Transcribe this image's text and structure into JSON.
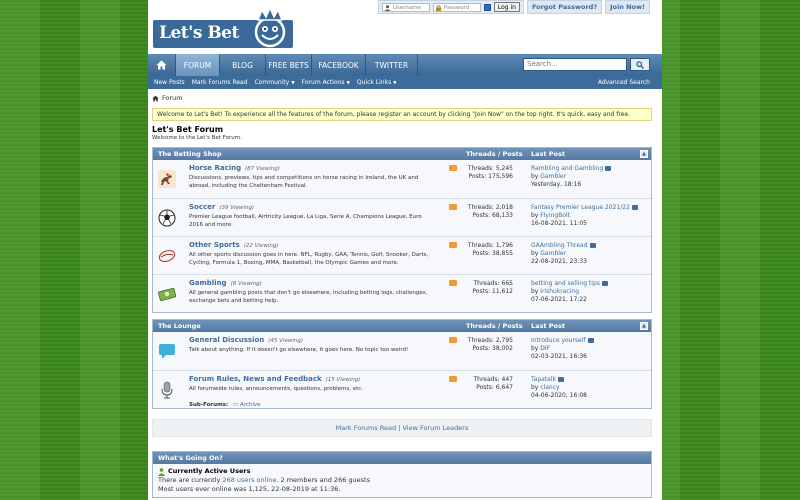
{
  "logo": {
    "text": "Let's Bet"
  },
  "login": {
    "username_placeholder": "Username",
    "password_placeholder": "Password",
    "login_label": "Log in",
    "forgot_label": "Forgot Password?",
    "join_label": "Join Now!"
  },
  "nav": {
    "tabs": [
      "FORUM",
      "BLOG",
      "FREE BETS",
      "FACEBOOK",
      "TWITTER"
    ],
    "search_placeholder": "Search..."
  },
  "subnav": {
    "items": [
      "New Posts",
      "Mark Forums Read",
      "Community",
      "Forum Actions",
      "Quick Links"
    ],
    "advanced": "Advanced Search"
  },
  "breadcrumb": "Forum",
  "notice": "Welcome to Let's Bet! To experience all the features of the forum, please register an account by clicking \"Join Now\" on the top right. It's quick, easy and free.",
  "forum_title": "Let's Bet Forum",
  "forum_subtitle": "Welcome to the Let's Bet Forum.",
  "columns": {
    "threads_posts": "Threads / Posts",
    "last_post": "Last Post"
  },
  "categories": [
    {
      "name": "The Betting Shop",
      "forums": [
        {
          "name": "Horse Racing",
          "viewing": "(87 Viewing)",
          "desc": "Discussions, previews, tips and competitions on horse racing in Ireland, the UK and abroad, including the Cheltenham Festival.",
          "threads": "Threads: 5,245",
          "posts": "Posts: 175,596",
          "lp_title": "Rambling and Gambling",
          "lp_by": "by",
          "lp_user": "Gambler",
          "lp_date": "Yesterday, 18:16"
        },
        {
          "name": "Soccer",
          "viewing": "(39 Viewing)",
          "desc": "Premier League football, Airtricity League, La Liga, Serie A, Champions League, Euro 2016 and more.",
          "threads": "Threads: 2,018",
          "posts": "Posts: 68,133",
          "lp_title": "Fantasy Premier League 2021/22",
          "lp_by": "by",
          "lp_user": "FlyingBolt",
          "lp_date": "16-08-2021, 11:05"
        },
        {
          "name": "Other Sports",
          "viewing": "(22 Viewing)",
          "desc": "All other sports discussion goes in here. NFL, Rugby, GAA, Tennis, Golf, Snooker, Darts, Cycling, Formula 1, Boxing, MMA, Basketball, the Olympic Games and more.",
          "threads": "Threads: 1,796",
          "posts": "Posts: 38,855",
          "lp_title": "GAAmbling Thread",
          "lp_by": "by",
          "lp_user": "Gambler",
          "lp_date": "22-08-2021, 23:33"
        },
        {
          "name": "Gambling",
          "viewing": "(8 Viewing)",
          "desc": "All general gambling posts that don't go elsewhere, including betting logs, challenges, exchange bets and betting help.",
          "threads": "Threads: 665",
          "posts": "Posts: 11,612",
          "lp_title": "betting and selling tips",
          "lp_by": "by",
          "lp_user": "irishukracing",
          "lp_date": "07-06-2021, 17:22"
        }
      ]
    },
    {
      "name": "The Lounge",
      "forums": [
        {
          "name": "General Discussion",
          "viewing": "(45 Viewing)",
          "desc": "Talk about anything. If it doesn't go elsewhere, it goes here. No topic too weird!",
          "threads": "Threads: 2,795",
          "posts": "Posts: 38,002",
          "lp_title": "Introduce yourself",
          "lp_by": "by",
          "lp_user": "DIF",
          "lp_date": "02-03-2021, 16:36"
        },
        {
          "name": "Forum Rules, News and Feedback",
          "viewing": "(15 Viewing)",
          "desc": "All forumwide rules, announcements, questions, problems, etc.",
          "threads": "Threads: 447",
          "posts": "Posts: 6,647",
          "lp_title": "Tapatalk",
          "lp_by": "by",
          "lp_user": "clancy",
          "lp_date": "04-06-2020, 16:08",
          "subforums_label": "Sub-Forums:",
          "subforum": "Archive"
        }
      ]
    }
  ],
  "mark_bar": {
    "mark": "Mark Forums Read",
    "sep": "|",
    "leaders": "View Forum Leaders"
  },
  "whats_going_on": {
    "title": "What's Going On?",
    "active_heading": "Currently Active Users",
    "line1_pre": "There are currently",
    "line1_link": "268 users online",
    "line1_post": ". 2 members and 266 guests",
    "line2": "Most users ever online was 1,125, 22-08-2019 at 11:36."
  }
}
